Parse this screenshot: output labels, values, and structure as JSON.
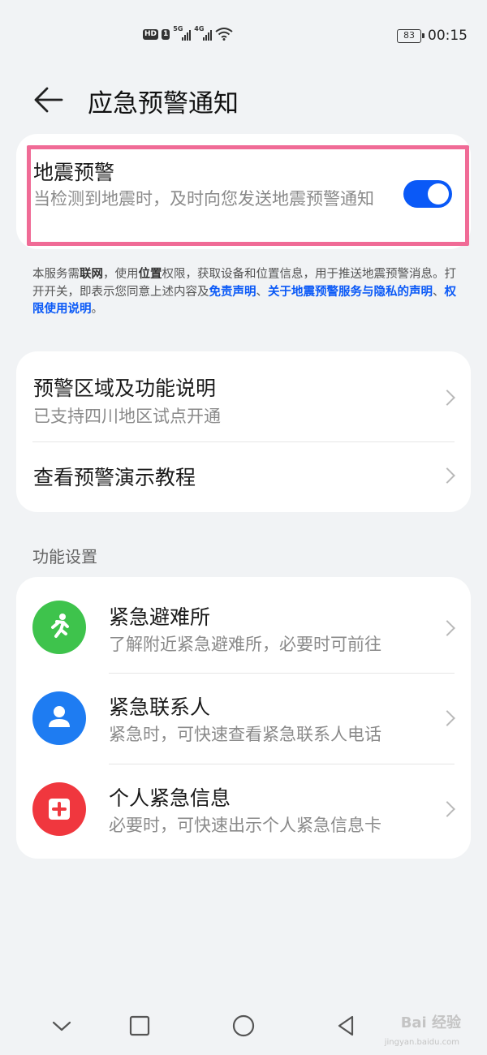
{
  "status_bar": {
    "hd": "HD",
    "sim1": "1",
    "net1": "5G",
    "net2": "4G",
    "battery": "83",
    "time": "00:15"
  },
  "header": {
    "title": "应急预警通知",
    "back_icon": "arrow-left-icon"
  },
  "earthquake": {
    "title": "地震预警",
    "subtitle": "当检测到地震时，及时向您发送地震预警通知",
    "enabled": true,
    "accent": "#0a59f7",
    "highlight_color": "#f06b96"
  },
  "notice": {
    "p1": "本服务需",
    "b1": "联网",
    "p2": "，使用",
    "b2": "位置",
    "p3": "权限，获取设备和位置信息，用于推送地震预警消息。打开开关，即表示您同意上述内容及",
    "link1": "免责声明",
    "sep1": "、",
    "link2": "关于地震预警服务与隐私的声明",
    "sep2": "、",
    "link3": "权限使用说明",
    "end": "。"
  },
  "info_card": {
    "items": [
      {
        "title": "预警区域及功能说明",
        "subtitle": "已支持四川地区试点开通"
      },
      {
        "title": "查看预警演示教程"
      }
    ]
  },
  "section_title": "功能设置",
  "features": [
    {
      "title": "紧急避难所",
      "subtitle": "了解附近紧急避难所，必要时可前往",
      "icon": "running-person-icon",
      "color": "#3ec34c"
    },
    {
      "title": "紧急联系人",
      "subtitle": "紧急时，可快速查看紧急联系人电话",
      "icon": "person-icon",
      "color": "#1e7cf2"
    },
    {
      "title": "个人紧急信息",
      "subtitle": "必要时，可快速出示个人紧急信息卡",
      "icon": "medical-card-icon",
      "color": "#f0373e"
    }
  ],
  "watermark": {
    "main": "Bai 经验",
    "sub": "jingyan.baidu.com"
  }
}
